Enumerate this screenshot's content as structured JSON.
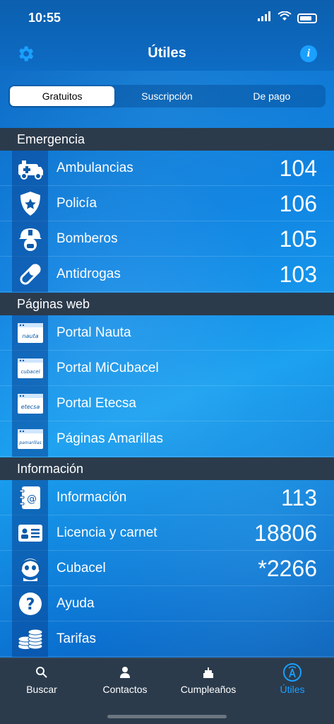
{
  "status": {
    "time": "10:55"
  },
  "nav": {
    "title": "Útiles"
  },
  "segments": [
    "Gratuitos",
    "Suscripción",
    "De pago"
  ],
  "sections": [
    {
      "title": "Emergencia"
    },
    {
      "title": "Páginas web"
    },
    {
      "title": "Información"
    }
  ],
  "emergencia": [
    {
      "label": "Ambulancias",
      "value": "104",
      "icon": "ambulance-icon"
    },
    {
      "label": "Policía",
      "value": "106",
      "icon": "police-badge-icon"
    },
    {
      "label": "Bomberos",
      "value": "105",
      "icon": "firefighter-icon"
    },
    {
      "label": "Antidrogas",
      "value": "103",
      "icon": "pill-icon"
    }
  ],
  "web": [
    {
      "label": "Portal Nauta",
      "badge": "nauta",
      "icon": "web-page-icon"
    },
    {
      "label": "Portal MiCubacel",
      "badge": "cubacel",
      "icon": "web-page-icon"
    },
    {
      "label": "Portal Etecsa",
      "badge": "etecsa",
      "icon": "web-page-icon"
    },
    {
      "label": "Páginas Amarillas",
      "badge": "pamarillas",
      "icon": "web-page-icon"
    }
  ],
  "informacion": [
    {
      "label": "Información",
      "value": "113",
      "icon": "address-book-icon"
    },
    {
      "label": "Licencia y carnet",
      "value": "18806",
      "icon": "id-card-icon"
    },
    {
      "label": "Cubacel",
      "value": "*2266",
      "icon": "operator-headset-icon"
    },
    {
      "label": "Ayuda",
      "value": "",
      "icon": "question-icon"
    },
    {
      "label": "Tarifas",
      "value": "",
      "icon": "coins-icon"
    }
  ],
  "tabs": [
    {
      "label": "Buscar",
      "icon": "search-icon"
    },
    {
      "label": "Contactos",
      "icon": "person-icon"
    },
    {
      "label": "Cumpleaños",
      "icon": "cake-icon"
    },
    {
      "label": "Útiles",
      "icon": "antenna-icon"
    }
  ],
  "colors": {
    "accent": "#1aa0ff",
    "header_bg": "#2b3b4c"
  }
}
